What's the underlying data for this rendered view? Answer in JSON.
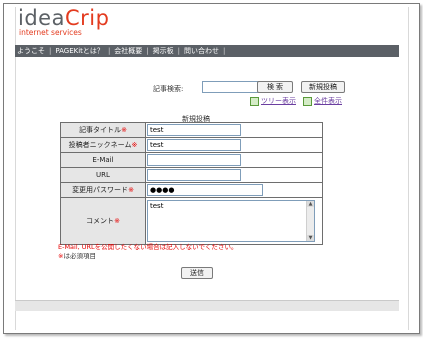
{
  "logo": {
    "part1": "idea",
    "part2": "Crip",
    "tagline": "internet services"
  },
  "nav": [
    "ようこそ",
    "PAGEKitとは？",
    "会社概要",
    "掲示板",
    "問い合わせ"
  ],
  "nav_sep": "|",
  "search": {
    "label": "記事検索:",
    "value": "",
    "search_button": "検 索",
    "new_post_button": "新規投稿"
  },
  "links": {
    "tree": "ツリー表示",
    "all": "全件表示"
  },
  "form": {
    "caption": "新規投稿",
    "title_label": "記事タイトル",
    "title_value": "test",
    "nick_label": "投稿者ニックネーム",
    "nick_value": "test",
    "email_label": "E-Mail",
    "email_value": "",
    "url_label": "URL",
    "url_value": "",
    "password_label": "変更用パスワード",
    "password_value": "●●●●",
    "comment_label": "コメント",
    "comment_value": "test",
    "required_mark": "※"
  },
  "notes": {
    "line1": "E-Mail, URLを公開したくない場合は記入しないでください。",
    "line2_mark": "※",
    "line2_text": "は必須項目"
  },
  "submit_label": "送信",
  "colors": {
    "brand_red": "#e33b1f",
    "nav_bg": "#5b6066",
    "required_red": "#e60000",
    "link_purple": "#6b3ea0"
  }
}
